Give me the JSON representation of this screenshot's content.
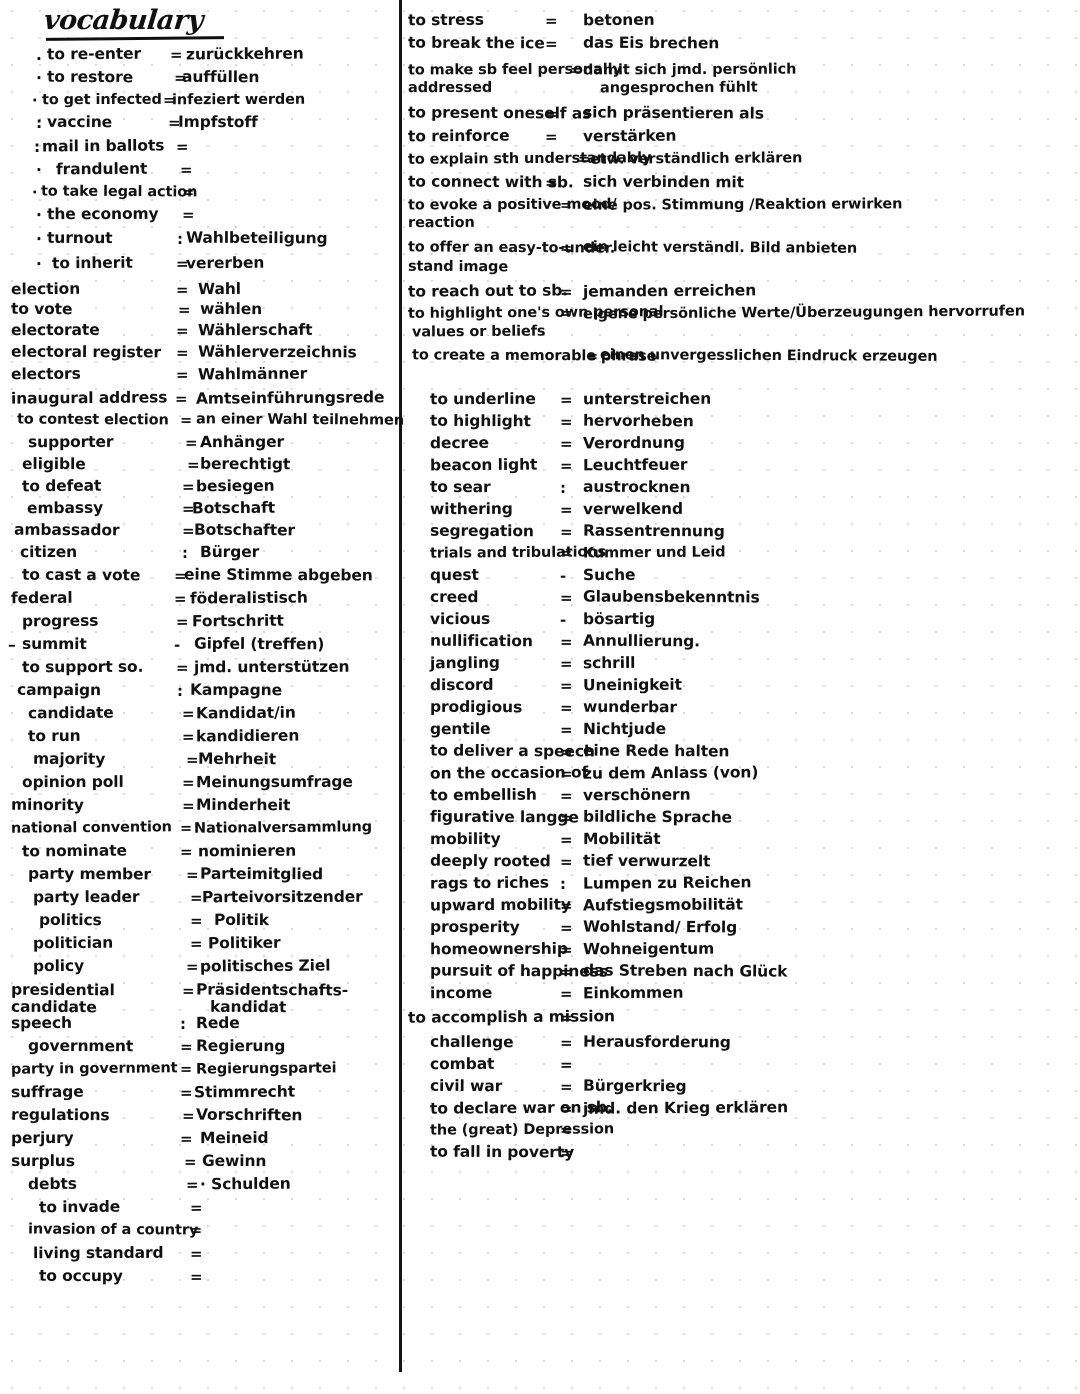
{
  "page": {
    "title": "vocabulary",
    "background": "#ffffff",
    "dot_grid_color": "#d8d8dc",
    "ink_color": "#111111"
  },
  "left_column": {
    "entries": [
      {
        "bullet": ".",
        "term": "to re-enter",
        "eq": "=",
        "translation": "zurückkehren"
      },
      {
        "bullet": "·",
        "term": "to restore",
        "eq": "=",
        "translation": "auffüllen"
      },
      {
        "bullet": "·",
        "term": "to get infected",
        "eq": "=",
        "translation": "infeziert werden"
      },
      {
        "bullet": ":",
        "term": "vaccine",
        "eq": "=",
        "translation": "Impfstoff"
      },
      {
        "bullet": ":",
        "term": "mail in ballots",
        "eq": "=",
        "translation": ""
      },
      {
        "bullet": "·",
        "term": "frandulent",
        "eq": "=",
        "translation": ""
      },
      {
        "bullet": "·",
        "term": "to take legal action",
        "eq": "=",
        "translation": ""
      },
      {
        "bullet": "·",
        "term": "the economy",
        "eq": "=",
        "translation": ""
      },
      {
        "bullet": "·",
        "term": "turnout",
        "eq": ":",
        "translation": "Wahlbeteiligung"
      },
      {
        "bullet": "·",
        "term": "to inherit",
        "eq": "=",
        "translation": "vererben"
      },
      {
        "bullet": "",
        "term": "election",
        "eq": "=",
        "translation": "Wahl"
      },
      {
        "bullet": "",
        "term": "to vote",
        "eq": "=",
        "translation": "wählen"
      },
      {
        "bullet": "",
        "term": "electorate",
        "eq": "=",
        "translation": "Wählerschaft"
      },
      {
        "bullet": "",
        "term": "electoral register",
        "eq": "=",
        "translation": "Wählerverzeichnis"
      },
      {
        "bullet": "",
        "term": "electors",
        "eq": "=",
        "translation": "Wahlmänner"
      },
      {
        "bullet": "",
        "term": "inaugural address",
        "eq": "=",
        "translation": "Amtseinführungsrede"
      },
      {
        "bullet": "",
        "term": "to contest election",
        "eq": "=",
        "translation": "an einer Wahl teilnehmen"
      },
      {
        "bullet": "",
        "term": "supporter",
        "eq": "=",
        "translation": "Anhänger"
      },
      {
        "bullet": "",
        "term": "eligible",
        "eq": "=",
        "translation": "berechtigt"
      },
      {
        "bullet": "",
        "term": "to defeat",
        "eq": "=",
        "translation": "besiegen"
      },
      {
        "bullet": "",
        "term": "embassy",
        "eq": "=",
        "translation": "Botschaft"
      },
      {
        "bullet": "",
        "term": "ambassador",
        "eq": "=",
        "translation": "Botschafter"
      },
      {
        "bullet": "",
        "term": "citizen",
        "eq": ":",
        "translation": "Bürger"
      },
      {
        "bullet": "",
        "term": "to cast a vote",
        "eq": "=",
        "translation": "eine Stimme abgeben"
      },
      {
        "bullet": "",
        "term": "federal",
        "eq": "=",
        "translation": "föderalistisch"
      },
      {
        "bullet": "",
        "term": "progress",
        "eq": "=",
        "translation": "Fortschritt"
      },
      {
        "bullet": "–",
        "term": "summit",
        "eq": "-",
        "translation": "Gipfel (treffen)"
      },
      {
        "bullet": "",
        "term": "to support so.",
        "eq": "=",
        "translation": "jmd. unterstützen"
      },
      {
        "bullet": "",
        "term": "campaign",
        "eq": ":",
        "translation": "Kampagne"
      },
      {
        "bullet": "",
        "term": "candidate",
        "eq": "=",
        "translation": "Kandidat/in"
      },
      {
        "bullet": "",
        "term": "to run",
        "eq": "=",
        "translation": "kandidieren"
      },
      {
        "bullet": "",
        "term": "majority",
        "eq": "=",
        "translation": "Mehrheit"
      },
      {
        "bullet": "",
        "term": "opinion poll",
        "eq": "=",
        "translation": "Meinungsumfrage"
      },
      {
        "bullet": "",
        "term": "minority",
        "eq": "=",
        "translation": "Minderheit"
      },
      {
        "bullet": "",
        "term": "national convention",
        "eq": "=",
        "translation": "Nationalversammlung"
      },
      {
        "bullet": "",
        "term": "to nominate",
        "eq": "=",
        "translation": "nominieren"
      },
      {
        "bullet": "",
        "term": "party member",
        "eq": "=",
        "translation": "Parteimitglied"
      },
      {
        "bullet": "",
        "term": "party leader",
        "eq": "=",
        "translation": "Parteivorsitzender"
      },
      {
        "bullet": "",
        "term": "politics",
        "eq": "=",
        "translation": "Politik"
      },
      {
        "bullet": "",
        "term": "politician",
        "eq": "=",
        "translation": "Politiker"
      },
      {
        "bullet": "",
        "term": "policy",
        "eq": "=",
        "translation": "politisches Ziel"
      },
      {
        "bullet": "",
        "term": "presidential",
        "eq": "=",
        "translation": "Präsidentschafts-",
        "term_line2": "candidate",
        "translation_line2": "kandidat"
      },
      {
        "bullet": "",
        "term": "speech",
        "eq": ":",
        "translation": "Rede"
      },
      {
        "bullet": "",
        "term": "government",
        "eq": "=",
        "translation": "Regierung"
      },
      {
        "bullet": "",
        "term": "party in government",
        "eq": "=",
        "translation": "Regierungspartei"
      },
      {
        "bullet": "",
        "term": "suffrage",
        "eq": "=",
        "translation": "Stimmrecht"
      },
      {
        "bullet": "",
        "term": "regulations",
        "eq": "=",
        "translation": "Vorschriften"
      },
      {
        "bullet": "",
        "term": "perjury",
        "eq": "=",
        "translation": "Meineid"
      },
      {
        "bullet": "",
        "term": "surplus",
        "eq": "=",
        "translation": "Gewinn"
      },
      {
        "bullet": "",
        "term": "debts",
        "eq": "=",
        "translation": "· Schulden"
      },
      {
        "bullet": "",
        "term": "to invade",
        "eq": "=",
        "translation": ""
      },
      {
        "bullet": "",
        "term": "invasion of a country",
        "eq": "=",
        "translation": ""
      },
      {
        "bullet": "",
        "term": "living standard",
        "eq": "=",
        "translation": ""
      },
      {
        "bullet": "",
        "term": "to occupy",
        "eq": "=",
        "translation": ""
      }
    ]
  },
  "right_column": {
    "entries": [
      {
        "term": "to stress",
        "eq": "=",
        "translation": "betonen"
      },
      {
        "term": "to break the ice",
        "eq": "=",
        "translation": "das Eis brechen"
      },
      {
        "term": "to make sb feel personally",
        "eq": "=",
        "translation": "damit sich jmd. persönlich",
        "term_line2": "addressed",
        "translation_line2": "angesprochen fühlt"
      },
      {
        "term": "to present oneself as",
        "eq": "=",
        "translation": "sich präsentieren als"
      },
      {
        "term": "to reinforce",
        "eq": "=",
        "translation": "verstärken"
      },
      {
        "term": "to explain sth understandably",
        "eq": "=",
        "translation": "etw. verständlich erklären"
      },
      {
        "term": "to connect with sb.",
        "eq": "=",
        "translation": "sich verbinden mit"
      },
      {
        "term": "to evoke a positive mood/",
        "eq": "=",
        "translation": "eine pos. Stimmung /Reaktion erwirken",
        "term_line2": "reaction"
      },
      {
        "term": "to offer an easy-to-under.",
        "eq": "=",
        "translation": "ein leicht verständl. Bild anbieten",
        "term_line2": "stand image"
      },
      {
        "term": "to reach out to sb.",
        "eq": "=",
        "translation": "jemanden erreichen"
      },
      {
        "term": "to highlight one's own personal",
        "eq": "=",
        "translation": "eigene persönliche Werte/Überzeugungen hervorrufen",
        "term_line2": "values or beliefs"
      },
      {
        "term": "to create a memorable phrase",
        "eq": "=",
        "translation": "einen unvergesslichen Eindruck erzeugen"
      },
      {
        "term": "to underline",
        "eq": "=",
        "translation": "unterstreichen"
      },
      {
        "term": "to highlight",
        "eq": "=",
        "translation": "hervorheben"
      },
      {
        "term": "decree",
        "eq": "=",
        "translation": "Verordnung"
      },
      {
        "term": "beacon light",
        "eq": "=",
        "translation": "Leuchtfeuer"
      },
      {
        "term": "to sear",
        "eq": ":",
        "translation": "austrocknen"
      },
      {
        "term": "withering",
        "eq": "=",
        "translation": "verwelkend"
      },
      {
        "term": "segregation",
        "eq": "=",
        "translation": "Rassentrennung"
      },
      {
        "term": "trials and tribulations",
        "eq": "=",
        "translation": "Kummer und Leid"
      },
      {
        "term": "quest",
        "eq": "-",
        "translation": "Suche"
      },
      {
        "term": "creed",
        "eq": "=",
        "translation": "Glaubensbekenntnis"
      },
      {
        "term": "vicious",
        "eq": "-",
        "translation": "bösartig"
      },
      {
        "term": "nullification",
        "eq": "=",
        "translation": "Annullierung."
      },
      {
        "term": "jangling",
        "eq": "=",
        "translation": "schrill"
      },
      {
        "term": "discord",
        "eq": "=",
        "translation": "Uneinigkeit"
      },
      {
        "term": "prodigious",
        "eq": "=",
        "translation": "wunderbar"
      },
      {
        "term": "gentile",
        "eq": "=",
        "translation": "Nichtjude"
      },
      {
        "term": "to deliver a speech",
        "eq": "=",
        "translation": "eine Rede halten"
      },
      {
        "term": "on the occasion of",
        "eq": "=",
        "translation": "zu dem Anlass (von)"
      },
      {
        "term": "to embellish",
        "eq": "=",
        "translation": "verschönern"
      },
      {
        "term": "figurative langge",
        "eq": "=",
        "translation": "bildliche Sprache"
      },
      {
        "term": "mobility",
        "eq": "=",
        "translation": "Mobilität"
      },
      {
        "term": "deeply rooted",
        "eq": "=",
        "translation": "tief verwurzelt"
      },
      {
        "term": "rags to riches",
        "eq": ":",
        "translation": "Lumpen zu Reichen"
      },
      {
        "term": "upward mobility",
        "eq": "=",
        "translation": "Aufstiegsmobilität"
      },
      {
        "term": "prosperity",
        "eq": "=",
        "translation": "Wohlstand/ Erfolg"
      },
      {
        "term": "homeownership",
        "eq": "=",
        "translation": "Wohneigentum"
      },
      {
        "term": "pursuit of happiness",
        "eq": "=",
        "translation": "das Streben nach Glück"
      },
      {
        "term": "income",
        "eq": "=",
        "translation": "Einkommen"
      },
      {
        "term": "to accomplish a mission",
        "eq": "=",
        "translation": ""
      },
      {
        "term": "challenge",
        "eq": "=",
        "translation": "Herausforderung"
      },
      {
        "term": "combat",
        "eq": "=",
        "translation": ""
      },
      {
        "term": "civil war",
        "eq": "=",
        "translation": "Bürgerkrieg"
      },
      {
        "term": "to declare war on sb.",
        "eq": "=",
        "translation": "jmd. den Krieg erklären"
      },
      {
        "term": "the (great) Depression",
        "eq": "=",
        "translation": ""
      },
      {
        "term": "to fall in poverty",
        "eq": "=",
        "translation": ""
      }
    ]
  }
}
